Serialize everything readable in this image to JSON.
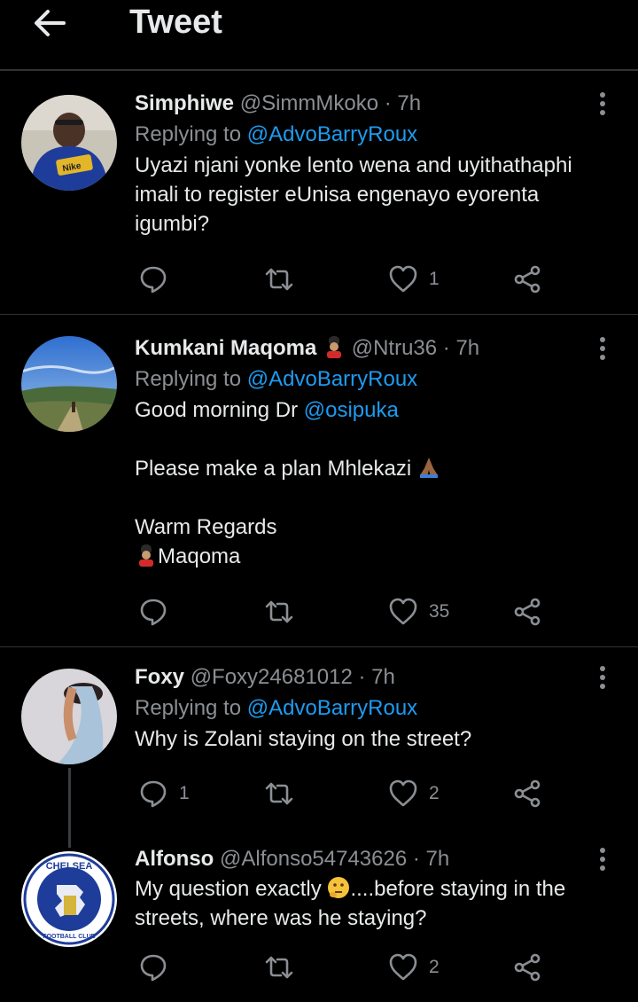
{
  "header": {
    "title": "Tweet",
    "back_icon": "back-arrow-icon"
  },
  "tweets": [
    {
      "name": "Simphiwe",
      "handle": "@SimmMkoko",
      "time": " · 7h",
      "replying_prefix": "Replying to ",
      "replying_handle": "@AdvoBarryRoux",
      "text_lines": [
        "Uyazi njani yonke lento wena and uyithathaphi imali to register eUnisa engenayo eyorenta igumbi?"
      ],
      "reply_count": "",
      "retweet_count": "",
      "like_count": "1"
    },
    {
      "name": "Kumkani Maqoma",
      "handle": "@Ntru36",
      "time": " · 7h",
      "replying_prefix": "Replying to ",
      "replying_handle": "@AdvoBarryRoux",
      "line1_text": "Good morning Dr ",
      "line1_mention": "@osipuka",
      "line2": "Please make a plan Mhlekazi ",
      "line3": "Warm Regards",
      "line4": "Maqoma",
      "reply_count": "",
      "retweet_count": "",
      "like_count": "35"
    },
    {
      "name": "Foxy",
      "handle": "@Foxy24681012",
      "time": " · 7h",
      "replying_prefix": "Replying to ",
      "replying_handle": "@AdvoBarryRoux",
      "text": "Why is Zolani staying on the street?",
      "reply_count": "1",
      "retweet_count": "",
      "like_count": "2"
    },
    {
      "name": "Alfonso",
      "handle": "@Alfonso54743626",
      "time": " · 7h",
      "text_a": "My question exactly ",
      "text_b": "....before staying in the streets, where was he staying?",
      "avatar_badge_top": "CHELSEA",
      "avatar_badge_bottom": "FOOTBALL CLUB",
      "reply_count": "",
      "retweet_count": "",
      "like_count": "2"
    }
  ],
  "icons": {
    "reply": "reply-bubble-icon",
    "retweet": "retweet-icon",
    "like": "heart-icon",
    "share": "share-icon",
    "more": "more-vertical-icon"
  },
  "colors": {
    "background": "#000000",
    "link": "#1d9bf0",
    "muted": "#8b8f93",
    "text": "#e7e9ea"
  }
}
